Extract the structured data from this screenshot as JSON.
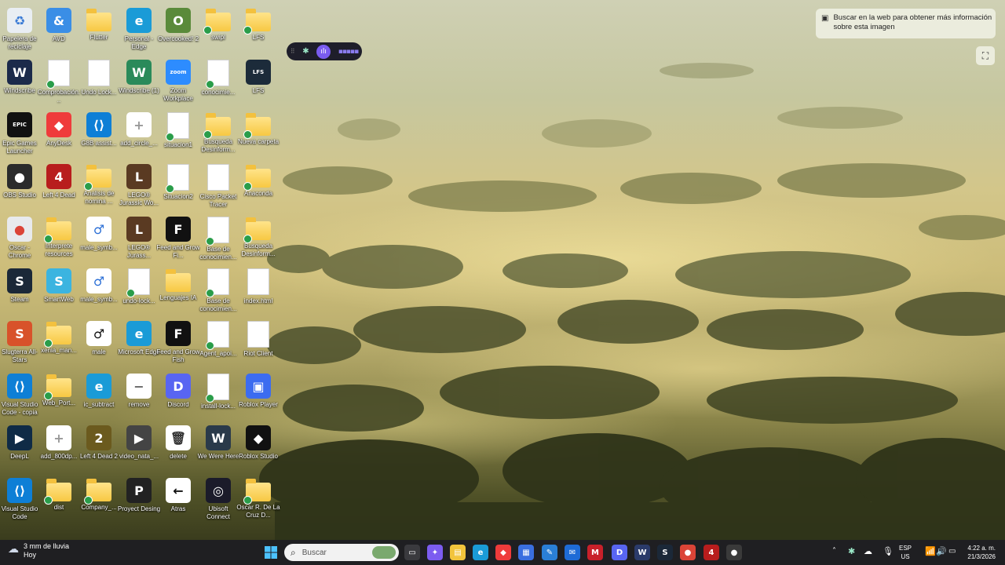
{
  "desktop": {
    "icons": [
      {
        "label": "Papelera de reciclaje",
        "glyph": "♻",
        "color": "#e9eef3",
        "fg": "#3a7bd5",
        "kind": "app",
        "check": false
      },
      {
        "label": "AVD",
        "glyph": "&",
        "color": "#3a8ee6",
        "fg": "#fff",
        "kind": "app",
        "check": true
      },
      {
        "label": "Flutter",
        "glyph": "",
        "color": "",
        "fg": "",
        "kind": "folder",
        "check": false
      },
      {
        "label": "Personal - Edge",
        "glyph": "e",
        "color": "#1a9bd7",
        "fg": "#fff",
        "kind": "app",
        "check": false
      },
      {
        "label": "Overcooked! 2",
        "glyph": "O",
        "color": "#5a8a3a",
        "fg": "#fff",
        "kind": "app",
        "check": false
      },
      {
        "label": "swipl",
        "glyph": "",
        "color": "",
        "fg": "",
        "kind": "folder",
        "check": true
      },
      {
        "label": "LFS",
        "glyph": "",
        "color": "",
        "fg": "",
        "kind": "folder",
        "check": true
      },
      {
        "label": "Windscribe",
        "glyph": "W",
        "color": "#1b2a4a",
        "fg": "#fff",
        "kind": "app",
        "check": false
      },
      {
        "label": "Comprobación...",
        "glyph": "",
        "color": "",
        "fg": "",
        "kind": "doc",
        "check": true
      },
      {
        "label": "Undo Lock...",
        "glyph": "",
        "color": "",
        "fg": "",
        "kind": "doc",
        "check": false
      },
      {
        "label": "Windscribe (1)",
        "glyph": "W",
        "color": "#2a8a5a",
        "fg": "#fff",
        "kind": "app",
        "check": true
      },
      {
        "label": "Zoom Workplace",
        "glyph": "zoom",
        "color": "#2d8cff",
        "fg": "#fff",
        "kind": "app",
        "check": false
      },
      {
        "label": "conocimie...",
        "glyph": "",
        "color": "",
        "fg": "",
        "kind": "doc",
        "check": true
      },
      {
        "label": "LFS",
        "glyph": "LFS",
        "color": "#1c2b3a",
        "fg": "#fff",
        "kind": "app",
        "check": false
      },
      {
        "label": "Epic Games Launcher",
        "glyph": "EPIC",
        "color": "#111",
        "fg": "#fff",
        "kind": "app",
        "check": false
      },
      {
        "label": "AnyDesk",
        "glyph": "◆",
        "color": "#ef3b3b",
        "fg": "#fff",
        "kind": "app",
        "check": false
      },
      {
        "label": "G8B assist...",
        "glyph": "⟨⟩",
        "color": "#0e7fd6",
        "fg": "#fff",
        "kind": "app",
        "check": true
      },
      {
        "label": "add_circle_...",
        "glyph": "+",
        "color": "#ffffff",
        "fg": "#999",
        "kind": "app",
        "check": true
      },
      {
        "label": "situacion1",
        "glyph": "",
        "color": "",
        "fg": "",
        "kind": "doc",
        "check": true
      },
      {
        "label": "Busqueda Desinform...",
        "glyph": "",
        "color": "",
        "fg": "",
        "kind": "folder",
        "check": true
      },
      {
        "label": "Nueva carpeta",
        "glyph": "",
        "color": "",
        "fg": "",
        "kind": "folder",
        "check": true
      },
      {
        "label": "OBS Studio",
        "glyph": "●",
        "color": "#2b2b2b",
        "fg": "#fff",
        "kind": "app",
        "check": false
      },
      {
        "label": "Left 4 Dead",
        "glyph": "4",
        "color": "#b81d1d",
        "fg": "#fff",
        "kind": "app",
        "check": true
      },
      {
        "label": "Analisis de nomina ...",
        "glyph": "",
        "color": "",
        "fg": "",
        "kind": "folder",
        "check": true
      },
      {
        "label": "LEGO® Jurassic Wo...",
        "glyph": "L",
        "color": "#5a3a22",
        "fg": "#fff",
        "kind": "app",
        "check": true
      },
      {
        "label": "Situacion2",
        "glyph": "",
        "color": "",
        "fg": "",
        "kind": "doc",
        "check": true
      },
      {
        "label": "Cisco Packet Tracer",
        "glyph": "",
        "color": "",
        "fg": "",
        "kind": "doc",
        "check": false
      },
      {
        "label": "Anaconda",
        "glyph": "",
        "color": "",
        "fg": "",
        "kind": "folder",
        "check": true
      },
      {
        "label": "Oscar - Chrome",
        "glyph": "●",
        "color": "#e8eaed",
        "fg": "#db4437",
        "kind": "app",
        "check": false
      },
      {
        "label": "Interprete resources",
        "glyph": "",
        "color": "",
        "fg": "",
        "kind": "folder",
        "check": true
      },
      {
        "label": "male_symb...",
        "glyph": "♂",
        "color": "#ffffff",
        "fg": "#2b6fd6",
        "kind": "app",
        "check": true
      },
      {
        "label": "LEGO® Jurass...",
        "glyph": "L",
        "color": "#5a3a22",
        "fg": "#fff",
        "kind": "app",
        "check": true
      },
      {
        "label": "Feed and Grow Fi...",
        "glyph": "F",
        "color": "#111",
        "fg": "#fff",
        "kind": "app",
        "check": true
      },
      {
        "label": "Base de conocimien...",
        "glyph": "",
        "color": "",
        "fg": "",
        "kind": "doc",
        "check": true
      },
      {
        "label": "Busqueda Desinform...",
        "glyph": "",
        "color": "",
        "fg": "",
        "kind": "folder",
        "check": true
      },
      {
        "label": "Steam",
        "glyph": "S",
        "color": "#1b2838",
        "fg": "#fff",
        "kind": "app",
        "check": false
      },
      {
        "label": "SmartWeb",
        "glyph": "S",
        "color": "#3bb4e0",
        "fg": "#fff",
        "kind": "app",
        "check": true
      },
      {
        "label": "male_symb...",
        "glyph": "♂",
        "color": "#ffffff",
        "fg": "#2b6fd6",
        "kind": "app",
        "check": true
      },
      {
        "label": "undo-lock...",
        "glyph": "",
        "color": "",
        "fg": "",
        "kind": "doc",
        "check": true
      },
      {
        "label": "Lenguajes IA",
        "glyph": "",
        "color": "",
        "fg": "",
        "kind": "folder",
        "check": false
      },
      {
        "label": "Base de conocimien...",
        "glyph": "",
        "color": "",
        "fg": "",
        "kind": "doc",
        "check": true
      },
      {
        "label": "index.html",
        "glyph": "",
        "color": "",
        "fg": "",
        "kind": "doc",
        "check": false
      },
      {
        "label": "Slugterra All-Stars",
        "glyph": "S",
        "color": "#d8522a",
        "fg": "#fff",
        "kind": "app",
        "check": false
      },
      {
        "label": "xenia_man...",
        "glyph": "",
        "color": "",
        "fg": "",
        "kind": "folder",
        "check": true
      },
      {
        "label": "male",
        "glyph": "♂",
        "color": "#ffffff",
        "fg": "#111",
        "kind": "app",
        "check": true
      },
      {
        "label": "Microsoft Edge",
        "glyph": "e",
        "color": "#1a9bd7",
        "fg": "#fff",
        "kind": "app",
        "check": false
      },
      {
        "label": "Feed and Grow Fish",
        "glyph": "F",
        "color": "#111",
        "fg": "#fff",
        "kind": "app",
        "check": false
      },
      {
        "label": "Agent_apoi...",
        "glyph": "",
        "color": "",
        "fg": "",
        "kind": "doc",
        "check": true
      },
      {
        "label": "Riot Client",
        "glyph": "",
        "color": "",
        "fg": "",
        "kind": "doc",
        "check": false
      },
      {
        "label": "Visual Studio Code - copia",
        "glyph": "⟨⟩",
        "color": "#0e7fd6",
        "fg": "#fff",
        "kind": "app",
        "check": true
      },
      {
        "label": "Web_Port...",
        "glyph": "",
        "color": "",
        "fg": "",
        "kind": "folder",
        "check": true
      },
      {
        "label": "ic_subtract",
        "glyph": "e",
        "color": "#1a9bd7",
        "fg": "#fff",
        "kind": "app",
        "check": true
      },
      {
        "label": "remove",
        "glyph": "−",
        "color": "#ffffff",
        "fg": "#666",
        "kind": "app",
        "check": false
      },
      {
        "label": "Discord",
        "glyph": "D",
        "color": "#5865f2",
        "fg": "#fff",
        "kind": "app",
        "check": false
      },
      {
        "label": "install-lock...",
        "glyph": "",
        "color": "",
        "fg": "",
        "kind": "doc",
        "check": true
      },
      {
        "label": "Roblox Player",
        "glyph": "▣",
        "color": "#3c6cf0",
        "fg": "#fff",
        "kind": "app",
        "check": false
      },
      {
        "label": "DeepL",
        "glyph": "▶",
        "color": "#0f2b46",
        "fg": "#fff",
        "kind": "app",
        "check": false
      },
      {
        "label": "add_800dp...",
        "glyph": "+",
        "color": "#ffffff",
        "fg": "#999",
        "kind": "app",
        "check": true
      },
      {
        "label": "Left 4 Dead 2",
        "glyph": "2",
        "color": "#6b5a1e",
        "fg": "#fff",
        "kind": "app",
        "check": false
      },
      {
        "label": "video_nata_...",
        "glyph": "▶",
        "color": "#444",
        "fg": "#fff",
        "kind": "app",
        "check": true
      },
      {
        "label": "delete",
        "glyph": "🗑",
        "color": "#ffffff",
        "fg": "#333",
        "kind": "app",
        "check": false
      },
      {
        "label": "We Were Here",
        "glyph": "W",
        "color": "#2a3a4a",
        "fg": "#fff",
        "kind": "app",
        "check": true
      },
      {
        "label": "Roblox Studio",
        "glyph": "◆",
        "color": "#111",
        "fg": "#fff",
        "kind": "app",
        "check": false
      },
      {
        "label": "Visual Studio Code",
        "glyph": "⟨⟩",
        "color": "#0e7fd6",
        "fg": "#fff",
        "kind": "app",
        "check": false
      },
      {
        "label": "dist",
        "glyph": "",
        "color": "",
        "fg": "",
        "kind": "folder",
        "check": true
      },
      {
        "label": "Company_...",
        "glyph": "",
        "color": "",
        "fg": "",
        "kind": "folder",
        "check": true
      },
      {
        "label": "Proyect Desing",
        "glyph": "P",
        "color": "#222",
        "fg": "#fff",
        "kind": "app",
        "check": false
      },
      {
        "label": "Atras",
        "glyph": "←",
        "color": "#ffffff",
        "fg": "#111",
        "kind": "app",
        "check": false
      },
      {
        "label": "Ubisoft Connect",
        "glyph": "◎",
        "color": "#1b1b2a",
        "fg": "#fff",
        "kind": "app",
        "check": false
      },
      {
        "label": "Oscar R. De La Cruz D...",
        "glyph": "",
        "color": "",
        "fg": "",
        "kind": "folder",
        "check": true
      }
    ]
  },
  "lens": {
    "tooltip": "Buscar en la web para obtener más información sobre esta imagen",
    "button_icon": "screenshot-search-icon"
  },
  "taskbar": {
    "weather_temp": "3 mm de lluvia",
    "weather_day": "Hoy",
    "search_placeholder": "Buscar",
    "apps": [
      {
        "name": "task-view",
        "glyph": "▭",
        "color": "#3a3a3e"
      },
      {
        "name": "copilot",
        "glyph": "✦",
        "color": "#7c5cf0"
      },
      {
        "name": "file-explorer",
        "glyph": "▤",
        "color": "#f2c43c"
      },
      {
        "name": "edge",
        "glyph": "e",
        "color": "#1a9bd7"
      },
      {
        "name": "anydesk",
        "glyph": "◆",
        "color": "#ef3b3b"
      },
      {
        "name": "store",
        "glyph": "▦",
        "color": "#3a6fe0"
      },
      {
        "name": "vscode",
        "glyph": "✎",
        "color": "#2a7fd6"
      },
      {
        "name": "mail",
        "glyph": "✉",
        "color": "#1e6bd6"
      },
      {
        "name": "mcafee",
        "glyph": "M",
        "color": "#c8202a"
      },
      {
        "name": "discord",
        "glyph": "D",
        "color": "#5865f2"
      },
      {
        "name": "windscribe",
        "glyph": "W",
        "color": "#2b3b6a"
      },
      {
        "name": "steam",
        "glyph": "S",
        "color": "#1b2838"
      },
      {
        "name": "chrome",
        "glyph": "●",
        "color": "#db4437"
      },
      {
        "name": "left4dead",
        "glyph": "4",
        "color": "#b81d1d"
      },
      {
        "name": "obs",
        "glyph": "●",
        "color": "#3a3a3a"
      }
    ],
    "language_top": "ESP",
    "language_bottom": "US",
    "time": "4:22 a. m.",
    "date": "21/3/2026"
  }
}
